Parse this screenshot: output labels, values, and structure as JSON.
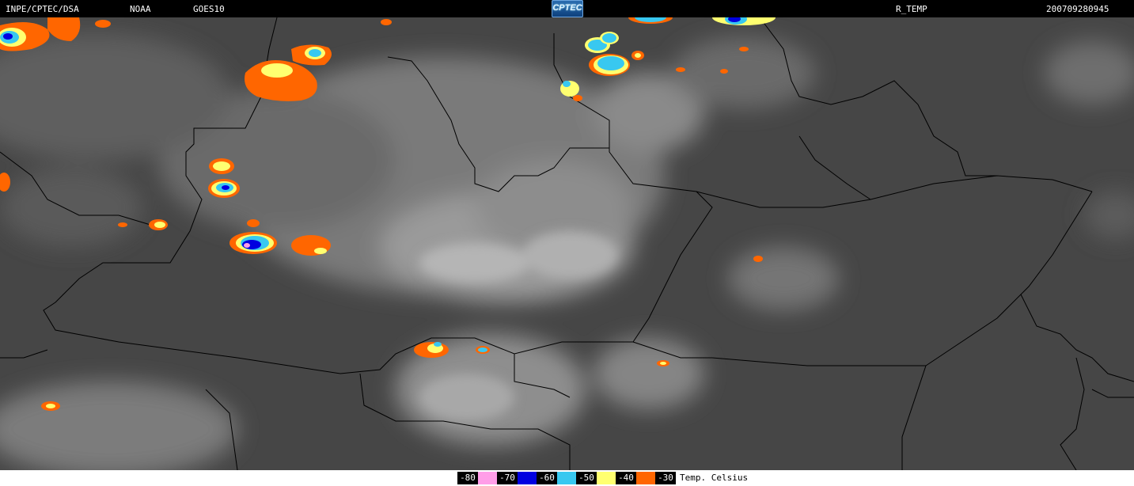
{
  "header": {
    "source": "INPE/CPTEC/DSA",
    "agency": "NOAA",
    "satellite": "GOES10",
    "logo_text": "CPTEC",
    "product": "R_TEMP",
    "timestamp": "200709280945"
  },
  "legend": {
    "items": [
      {
        "value": "-80",
        "color": "#ff9ee8"
      },
      {
        "value": "-70",
        "color": "#0000e0"
      },
      {
        "value": "-60",
        "color": "#38c8f0"
      },
      {
        "value": "-50",
        "color": "#ffff70"
      },
      {
        "value": "-40",
        "color": "#ff6600"
      },
      {
        "value": "-30",
        "color": ""
      }
    ],
    "unit": "Temp. Celsius"
  },
  "colors": {
    "background": "#464646",
    "cloud": "#bdbdbd",
    "border_line": "#000000"
  }
}
